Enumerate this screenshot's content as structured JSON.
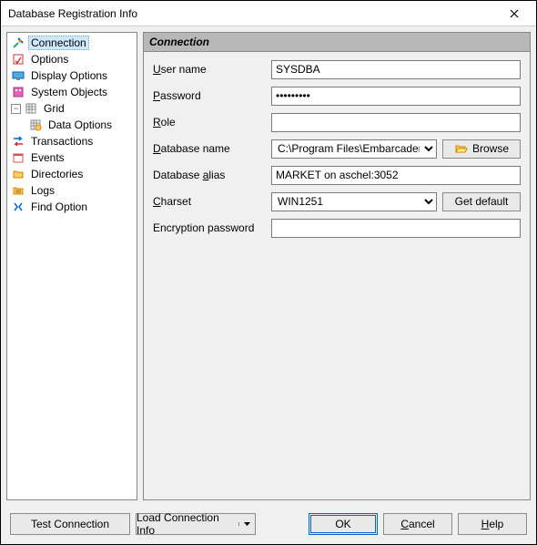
{
  "title": "Database Registration Info",
  "tree": {
    "items": [
      {
        "label": "Connection"
      },
      {
        "label": "Options"
      },
      {
        "label": "Display Options"
      },
      {
        "label": "System Objects"
      },
      {
        "label": "Grid"
      },
      {
        "label": "Data Options"
      },
      {
        "label": "Transactions"
      },
      {
        "label": "Events"
      },
      {
        "label": "Directories"
      },
      {
        "label": "Logs"
      },
      {
        "label": "Find Option"
      }
    ],
    "collapse_symbol": "−"
  },
  "panel": {
    "header": "Connection",
    "labels": {
      "username": "ser name",
      "username_u": "U",
      "password": "assword",
      "password_u": "P",
      "role": "ole",
      "role_u": "R",
      "database_name": "atabase name",
      "database_name_u": "D",
      "database_alias": "Database alias",
      "database_alias_u": "a",
      "charset": "harset",
      "charset_u": "C",
      "enc_password": "Encryption password"
    },
    "values": {
      "username": "SYSDBA",
      "password": "•••••••••",
      "role": "",
      "database_name": "C:\\Program Files\\Embarcadero\\",
      "database_alias": "MARKET on aschel:3052",
      "charset": "WIN1251",
      "enc_password": ""
    },
    "buttons": {
      "browse": "Browse",
      "get_default": "Get default"
    }
  },
  "footer": {
    "test": "Test Connection",
    "load": "Load Connection Info",
    "ok": "OK",
    "cancel": "ancel",
    "cancel_u": "C",
    "help": "elp",
    "help_u": "H"
  }
}
